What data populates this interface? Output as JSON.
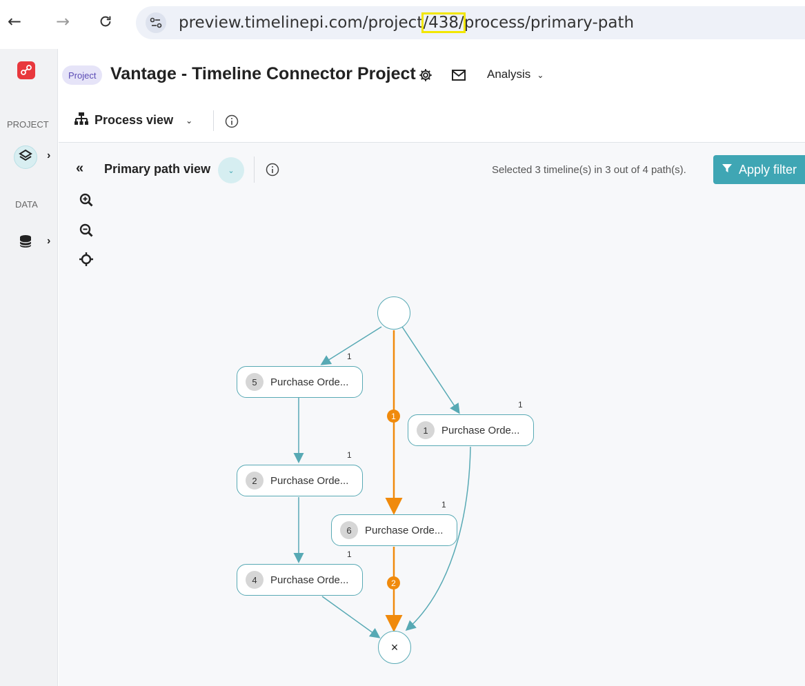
{
  "browser": {
    "url_before": "preview.timelinepi.com/project",
    "url_highlight": "/438/",
    "url_after": "process/primary-path"
  },
  "sidebar": {
    "project_label": "PROJECT",
    "data_label": "DATA"
  },
  "header": {
    "badge": "Project",
    "title": "Vantage - Timeline Connector Project",
    "analysis_label": "Analysis"
  },
  "view": {
    "label": "Process view"
  },
  "primary_path": {
    "label": "Primary path view",
    "status": "Selected 3 timeline(s) in 3 out of 4 path(s).",
    "apply_label": "Apply filter"
  },
  "graph": {
    "nodes": [
      {
        "num": "5",
        "label": "Purchase Orde..."
      },
      {
        "num": "1",
        "label": "Purchase Orde..."
      },
      {
        "num": "2",
        "label": "Purchase Orde..."
      },
      {
        "num": "6",
        "label": "Purchase Orde..."
      },
      {
        "num": "4",
        "label": "Purchase Orde..."
      }
    ],
    "edge_counts": [
      "1",
      "1",
      "1",
      "1",
      "1"
    ],
    "path_badges": [
      "1",
      "2"
    ],
    "end_symbol": "×"
  },
  "colors": {
    "accent": "#3fa6b4",
    "edge": "#57a9b4",
    "primary_path": "#f08a0c",
    "logo": "#e8383d"
  }
}
